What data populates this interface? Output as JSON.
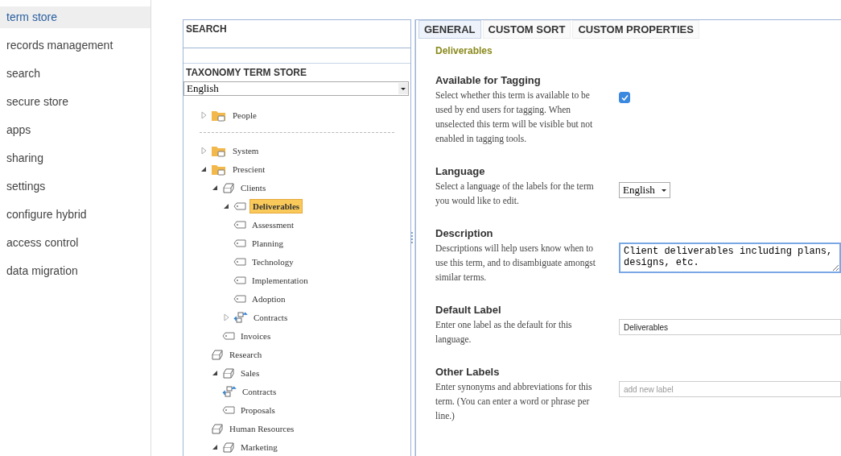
{
  "sidebar": {
    "items": [
      {
        "label": "term store",
        "selected": true
      },
      {
        "label": "records management",
        "selected": false
      },
      {
        "label": "search",
        "selected": false
      },
      {
        "label": "secure store",
        "selected": false
      },
      {
        "label": "apps",
        "selected": false
      },
      {
        "label": "sharing",
        "selected": false
      },
      {
        "label": "settings",
        "selected": false
      },
      {
        "label": "configure hybrid",
        "selected": false
      },
      {
        "label": "access control",
        "selected": false
      },
      {
        "label": "data migration",
        "selected": false
      }
    ]
  },
  "left_panel": {
    "search_title": "SEARCH",
    "store_title": "TAXONOMY TERM STORE",
    "language": "English",
    "tree": [
      {
        "kind": "group",
        "label": "People",
        "expanded": false,
        "selected": false
      },
      {
        "kind": "separator"
      },
      {
        "kind": "group",
        "label": "System",
        "expanded": false,
        "selected": false
      },
      {
        "kind": "group",
        "label": "Prescient",
        "expanded": true,
        "selected": false,
        "children": [
          {
            "kind": "termset",
            "label": "Clients",
            "expanded": true,
            "selected": false,
            "children": [
              {
                "kind": "term",
                "label": "Deliverables",
                "expanded": true,
                "selected": true,
                "children": [
                  {
                    "kind": "term",
                    "label": "Assessment",
                    "selected": false
                  },
                  {
                    "kind": "term",
                    "label": "Planning",
                    "selected": false
                  },
                  {
                    "kind": "term",
                    "label": "Technology",
                    "selected": false
                  },
                  {
                    "kind": "term",
                    "label": "Implementation",
                    "selected": false
                  },
                  {
                    "kind": "term",
                    "label": "Adoption",
                    "selected": false
                  }
                ]
              },
              {
                "kind": "shared",
                "label": "Contracts",
                "expanded": false,
                "selected": false
              },
              {
                "kind": "term",
                "label": "Invoices",
                "selected": false
              }
            ]
          },
          {
            "kind": "termset",
            "label": "Research",
            "selected": false
          },
          {
            "kind": "termset",
            "label": "Sales",
            "expanded": true,
            "selected": false,
            "children": [
              {
                "kind": "shared",
                "label": "Contracts",
                "selected": false
              },
              {
                "kind": "term",
                "label": "Proposals",
                "selected": false
              }
            ]
          },
          {
            "kind": "termset",
            "label": "Human Resources",
            "selected": false
          },
          {
            "kind": "termset",
            "label": "Marketing",
            "expanded": true,
            "selected": false
          }
        ]
      }
    ]
  },
  "right_panel": {
    "tabs": [
      {
        "label": "GENERAL",
        "selected": true
      },
      {
        "label": "CUSTOM SORT",
        "selected": false
      },
      {
        "label": "CUSTOM PROPERTIES",
        "selected": false
      }
    ],
    "term_title": "Deliverables",
    "sections": [
      {
        "kind": "checkbox",
        "title": "Available for Tagging",
        "help": "Select whether this term is available to be used by end users for tagging. When unselected this term will be visible but not enabled in tagging tools.",
        "checked": true
      },
      {
        "kind": "select",
        "title": "Language",
        "help": "Select a language of the labels for the term you would like to edit.",
        "value": "English"
      },
      {
        "kind": "textarea",
        "title": "Description",
        "help": "Descriptions will help users know when to use this term, and to disambiguate amongst similar terms.",
        "value": "Client deliverables including plans, designs, etc."
      },
      {
        "kind": "input",
        "title": "Default Label",
        "help": "Enter one label as the default for this language.",
        "value": "Deliverables"
      },
      {
        "kind": "input",
        "title": "Other Labels",
        "help": "Enter synonyms and abbreviations for this term. (You can enter a word or phrase per line.)",
        "placeholder": "add new label"
      }
    ]
  }
}
